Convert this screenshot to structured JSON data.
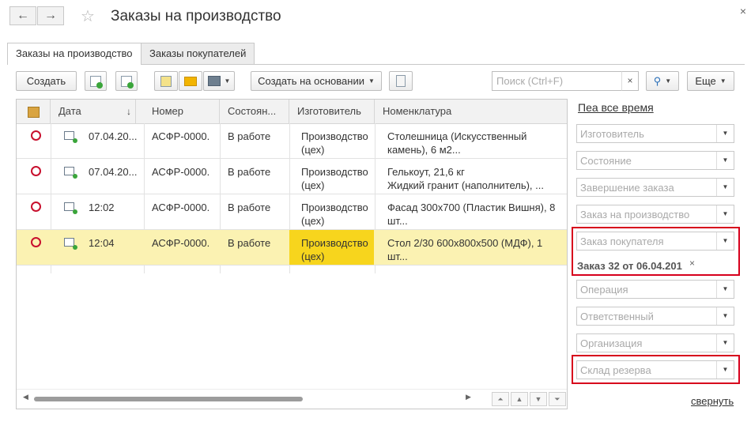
{
  "window": {
    "title": "Заказы на производство",
    "back_icon": "←",
    "forward_icon": "→",
    "star_icon": "☆",
    "close_icon": "×"
  },
  "tabs": [
    {
      "label": "Заказы на производство",
      "active": true
    },
    {
      "label": "Заказы покупателей",
      "active": false
    }
  ],
  "toolbar": {
    "create_label": "Создать",
    "create_based_label": "Создать на основании",
    "search_placeholder": "Поиск (Ctrl+F)",
    "search_clear": "×",
    "search_icon": "🔍",
    "more_label": "Еще",
    "icons": [
      "add-copy-icon",
      "table-add-icon",
      "report-icon",
      "mail-icon",
      "print-icon",
      "document-icon"
    ]
  },
  "table": {
    "columns": [
      "Дата",
      "Номер",
      "Состоян...",
      "Изготовитель",
      "Номенклатура"
    ],
    "sort_arrow": "↓",
    "rows": [
      {
        "date": "07.04.20...",
        "number": "АСФР-0000.",
        "state": "В работе",
        "maker1": "Производство",
        "maker2": "(цех)",
        "item1": "Столешница (Искусственный",
        "item2": "камень), 6 м2...",
        "selected": false
      },
      {
        "date": "07.04.20...",
        "number": "АСФР-0000.",
        "state": "В работе",
        "maker1": "Производство",
        "maker2": "(цех)",
        "item1": "Гелькоут, 21,6 кг",
        "item2": "Жидкий гранит (наполнитель), ...",
        "selected": false
      },
      {
        "date": "12:02",
        "number": "АСФР-0000.",
        "state": "В работе",
        "maker1": "Производство",
        "maker2": "(цех)",
        "item1": "Фасад 300х700 (Пластик Вишня), 8",
        "item2": "шт...",
        "selected": false
      },
      {
        "date": "12:04",
        "number": "АСФР-0000.",
        "state": "В работе",
        "maker1": "Производство",
        "maker2": "(цех)",
        "item1": "Стол 2/30 600х800х500 (МДФ), 1",
        "item2": "шт...",
        "selected": true
      }
    ]
  },
  "filters": {
    "period_label": "Пеа все время",
    "fields": [
      "Изготовитель",
      "Состояние",
      "Завершение заказа",
      "Заказ на производство",
      "Заказ покупателя",
      "Операция",
      "Ответственный",
      "Организация",
      "Склад резерва"
    ],
    "selected_tag": "Заказ 32 от 06.04.201",
    "tag_remove": "×",
    "collapse_label": "свернуть",
    "highlight_color": "#d7001c"
  }
}
